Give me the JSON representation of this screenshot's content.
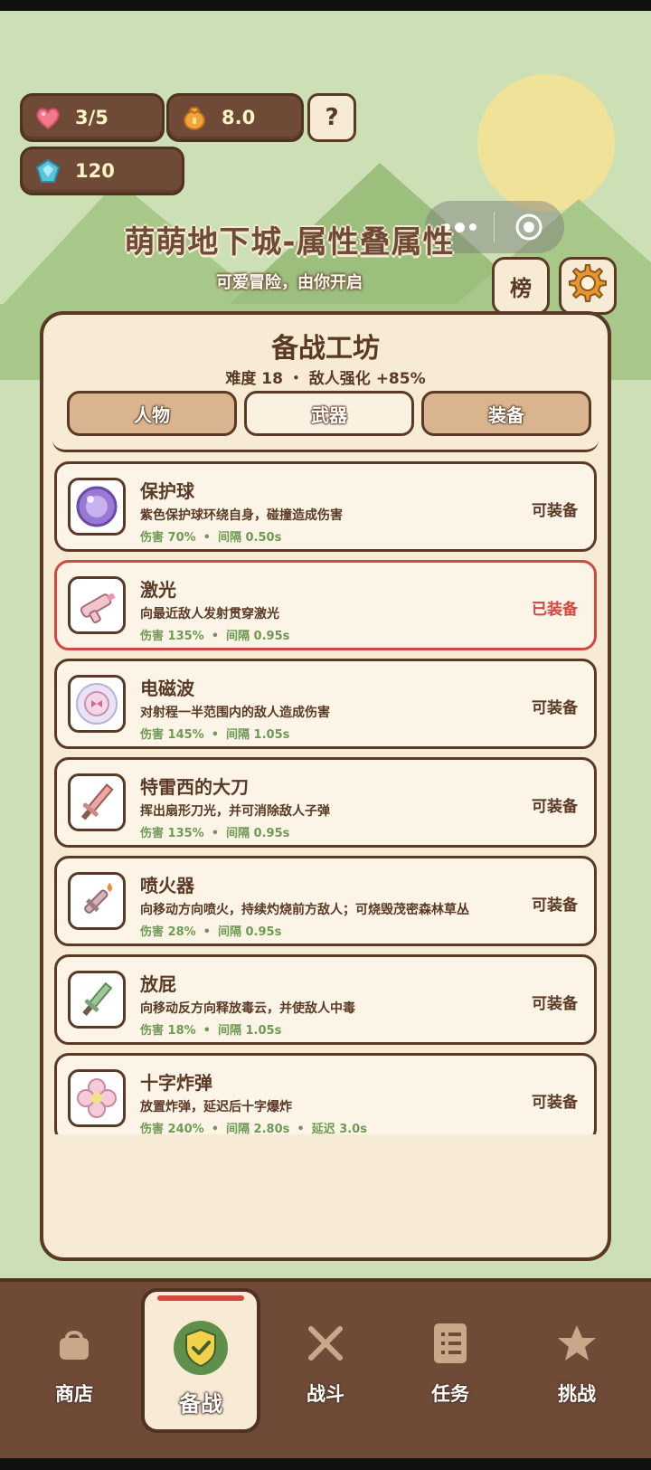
{
  "stats": {
    "lives": "3/5",
    "coins": "8.0",
    "gems": "120",
    "help_label": "?"
  },
  "header": {
    "title": "萌萌地下城-属性叠属性",
    "subtitle": "可爱冒险，由你开启",
    "rank_label": "榜"
  },
  "panel": {
    "title": "备战工坊",
    "subtitle": "难度 18 ・ 敌人强化 +85%",
    "tabs": [
      {
        "label": "人物",
        "active": false
      },
      {
        "label": "武器",
        "active": true
      },
      {
        "label": "装备",
        "active": false
      }
    ]
  },
  "weapons": [
    {
      "name": "保护球",
      "desc": "紫色保护球环绕自身，碰撞造成伤害",
      "damage": "伤害 70%",
      "interval": "间隔 0.50s",
      "extra": "",
      "status": "可装备",
      "icon": "purple-orb-icon"
    },
    {
      "name": "激光",
      "desc": "向最近敌人发射贯穿激光",
      "damage": "伤害 135%",
      "interval": "间隔 0.95s",
      "extra": "",
      "status": "已装备",
      "icon": "laser-gun-icon"
    },
    {
      "name": "电磁波",
      "desc": "对射程一半范围内的敌人造成伤害",
      "damage": "伤害 145%",
      "interval": "间隔 1.05s",
      "extra": "",
      "status": "可装备",
      "icon": "emp-wave-icon"
    },
    {
      "name": "特雷西的大刀",
      "desc": "挥出扇形刀光，并可消除敌人子弹",
      "damage": "伤害 135%",
      "interval": "间隔 0.95s",
      "extra": "",
      "status": "可装备",
      "icon": "big-sword-icon"
    },
    {
      "name": "喷火器",
      "desc": "向移动方向喷火，持续灼烧前方敌人；可烧毁茂密森林草丛",
      "damage": "伤害 28%",
      "interval": "间隔 0.95s",
      "extra": "",
      "status": "可装备",
      "icon": "flamethrower-icon"
    },
    {
      "name": "放屁",
      "desc": "向移动反方向释放毒云，并使敌人中毒",
      "damage": "伤害 18%",
      "interval": "间隔 1.05s",
      "extra": "",
      "status": "可装备",
      "icon": "poison-cloud-icon"
    },
    {
      "name": "十字炸弹",
      "desc": "放置炸弹，延迟后十字爆炸",
      "damage": "伤害 240%",
      "interval": "间隔 2.80s",
      "extra": "延迟 3.0s",
      "status": "可装备",
      "icon": "cross-bomb-icon"
    }
  ],
  "nav": [
    {
      "label": "商店",
      "icon": "bag-icon",
      "active": false
    },
    {
      "label": "备战",
      "icon": "shield-check-icon",
      "active": true
    },
    {
      "label": "战斗",
      "icon": "crossed-swords-icon",
      "active": false
    },
    {
      "label": "任务",
      "icon": "task-list-icon",
      "active": false
    },
    {
      "label": "挑战",
      "icon": "star-icon",
      "active": false
    }
  ],
  "colors": {
    "background": "#cde0b5",
    "panel": "#f8ebd6",
    "border": "#5a3a25",
    "equipped": "#d0483f",
    "stat_green": "#6f9a55",
    "nav": "#6e4a37"
  }
}
